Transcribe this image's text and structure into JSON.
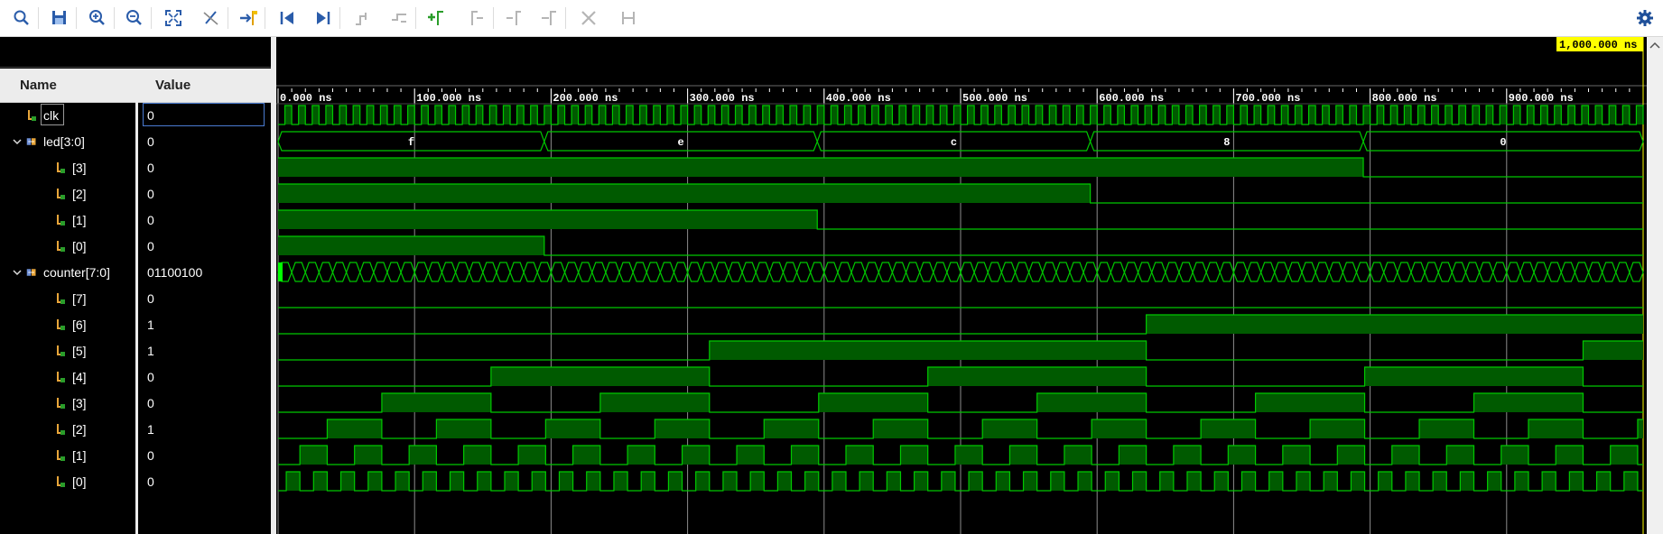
{
  "toolbar": {
    "buttons": [
      {
        "icon": "search-icon"
      },
      {
        "icon": "save-icon"
      },
      {
        "icon": "zoom-in-icon"
      },
      {
        "icon": "zoom-out-icon"
      },
      {
        "icon": "zoom-fit-icon"
      },
      {
        "icon": "cursor-disable-icon"
      },
      {
        "icon": "go-to-cursor-icon"
      },
      {
        "icon": "go-to-start-icon"
      },
      {
        "icon": "go-to-end-icon"
      },
      {
        "icon": "previous-transition-icon"
      },
      {
        "icon": "next-transition-icon"
      },
      {
        "icon": "add-marker-icon"
      },
      {
        "icon": "previous-marker-icon"
      },
      {
        "icon": "next-marker-icon"
      },
      {
        "icon": "swap-cursors-icon"
      },
      {
        "icon": "remove-marker-icon"
      },
      {
        "icon": "snap-to-transition-icon"
      }
    ],
    "settings_icon": "gear-icon"
  },
  "headers": {
    "name": "Name",
    "value": "Value"
  },
  "cursor_label": "1,000.000 ns",
  "timeline": {
    "unit": "ns",
    "ticks": [
      "0.000 ns",
      "100.000 ns",
      "200.000 ns",
      "300.000 ns",
      "400.000 ns",
      "500.000 ns",
      "600.000 ns",
      "700.000 ns",
      "800.000 ns",
      "900.000 ns"
    ]
  },
  "signals": [
    {
      "name": "clk",
      "value": "0"
    },
    {
      "name": "led[3:0]",
      "value": "0"
    },
    {
      "name": "[3]",
      "value": "0"
    },
    {
      "name": "[2]",
      "value": "0"
    },
    {
      "name": "[1]",
      "value": "0"
    },
    {
      "name": "[0]",
      "value": "0"
    },
    {
      "name": "counter[7:0]",
      "value": "01100100"
    },
    {
      "name": "[7]",
      "value": "0"
    },
    {
      "name": "[6]",
      "value": "1"
    },
    {
      "name": "[5]",
      "value": "1"
    },
    {
      "name": "[4]",
      "value": "0"
    },
    {
      "name": "[3]",
      "value": "0"
    },
    {
      "name": "[2]",
      "value": "1"
    },
    {
      "name": "[1]",
      "value": "0"
    },
    {
      "name": "[0]",
      "value": "0"
    }
  ],
  "led_bus_values": [
    "f",
    "e",
    "c",
    "8",
    "0"
  ],
  "colors": {
    "wave": "#00c800",
    "wave_fill": "#005a00",
    "grid": "#8c8c8c",
    "cursor_label_bg": "#ffff00"
  }
}
